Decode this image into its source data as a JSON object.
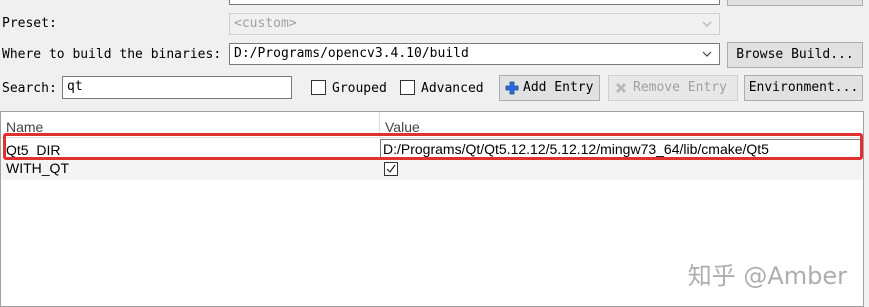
{
  "toolbar": {
    "preset_label": "Preset:",
    "preset_value": "<custom>",
    "build_label": "Where to build the binaries:",
    "build_value": "D:/Programs/opencv3.4.10/build",
    "browse_build_label": "Browse Build...",
    "search_label": "Search:",
    "search_value": "qt",
    "grouped_label": "Grouped",
    "advanced_label": "Advanced",
    "add_entry_label": "Add Entry",
    "remove_entry_label": "Remove Entry",
    "environment_label": "Environment..."
  },
  "table": {
    "columns": [
      "Name",
      "Value"
    ],
    "rows": [
      {
        "name": "Qt5_DIR",
        "value": "D:/Programs/Qt/Qt5.12.12/5.12.12/mingw73_64/lib/cmake/Qt5",
        "highlighted": true
      },
      {
        "name": "WITH_QT",
        "value": "",
        "checked": true
      }
    ]
  },
  "watermark": "知乎 @Amber",
  "colors": {
    "highlight_border": "#e03030",
    "add_icon": "#2b6bd6"
  }
}
